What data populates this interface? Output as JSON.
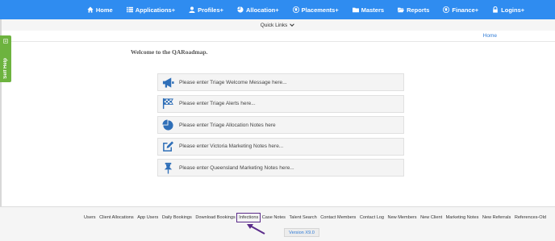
{
  "topnav": {
    "items": [
      {
        "label": "Home",
        "icon": "home-icon"
      },
      {
        "label": "Applications+",
        "icon": "list-icon"
      },
      {
        "label": "Profiles+",
        "icon": "user-icon"
      },
      {
        "label": "Allocation+",
        "icon": "pie-icon"
      },
      {
        "label": "Placements+",
        "icon": "globe-icon"
      },
      {
        "label": "Masters",
        "icon": "folder-icon"
      },
      {
        "label": "Reports",
        "icon": "folder-open-icon"
      },
      {
        "label": "Finance+",
        "icon": "globe-icon"
      },
      {
        "label": "Logins+",
        "icon": "lock-icon"
      }
    ],
    "color": "#2f8cf0"
  },
  "quick_links": {
    "label": "Quick Links"
  },
  "self_help": {
    "label": "Self Help",
    "color": "#6db33f"
  },
  "breadcrumb": {
    "label": "Home"
  },
  "welcome": {
    "text": "Welcome to the QARoadmap."
  },
  "notes": [
    {
      "text": "Please enter Triage Welcome Message here...",
      "icon": "megaphone-icon"
    },
    {
      "text": "Please enter Triage Alerts here...",
      "icon": "checkered-flag-icon"
    },
    {
      "text": "Please enter Triage Allocation Notes here",
      "icon": "pie-chart-icon"
    },
    {
      "text": "Please enter Victoria Marketing Notes here...",
      "icon": "edit-icon"
    },
    {
      "text": "Please enter Queensland Marketing Notes here...",
      "icon": "pin-icon"
    }
  ],
  "footer": {
    "links": [
      "Users",
      "Client Allocations",
      "App Users",
      "Daily Bookings",
      "Download Bookings",
      "Infections",
      "Case Notes",
      "Talent Search",
      "Contact Members",
      "Contact Log",
      "New Members",
      "New Client",
      "Marketing Notes",
      "New Referrals",
      "References-Old"
    ],
    "highlighted": "Infections",
    "version": "Version X9.0",
    "highlight_color": "#5b2c8a"
  }
}
